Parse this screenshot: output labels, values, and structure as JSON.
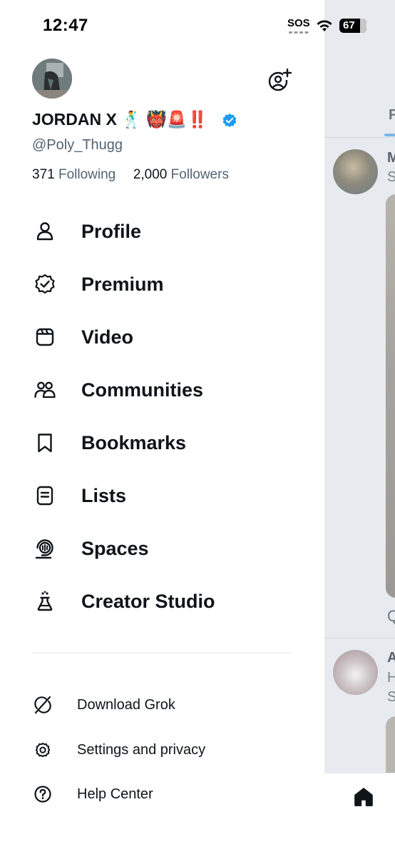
{
  "status_bar": {
    "time": "12:47",
    "carrier": "SOS",
    "battery": "67"
  },
  "profile": {
    "display_name": "JORDAN X 🕺 👹🚨‼️",
    "handle": "@Poly_Thugg",
    "following_count": "371",
    "following_label": "Following",
    "followers_count": "2,000",
    "followers_label": "Followers",
    "verified_color": "#1d9bf0"
  },
  "menu": {
    "items": [
      {
        "label": "Profile",
        "icon": "person-icon"
      },
      {
        "label": "Premium",
        "icon": "badge-check-icon"
      },
      {
        "label": "Video",
        "icon": "video-icon"
      },
      {
        "label": "Communities",
        "icon": "communities-icon"
      },
      {
        "label": "Bookmarks",
        "icon": "bookmark-icon"
      },
      {
        "label": "Lists",
        "icon": "list-icon"
      },
      {
        "label": "Spaces",
        "icon": "spaces-icon"
      },
      {
        "label": "Creator Studio",
        "icon": "flask-icon"
      }
    ]
  },
  "secondary_menu": {
    "items": [
      {
        "label": "Download Grok",
        "icon": "grok-icon"
      },
      {
        "label": "Settings and privacy",
        "icon": "gear-icon"
      },
      {
        "label": "Help Center",
        "icon": "help-icon"
      }
    ]
  },
  "feed": {
    "tab_label": "F",
    "post1_letter": "M",
    "post1_sub": "S",
    "post2_letter": "A",
    "post2_sub1": "H",
    "post2_sub2": "S",
    "accent_color": "#1d9bf0"
  }
}
